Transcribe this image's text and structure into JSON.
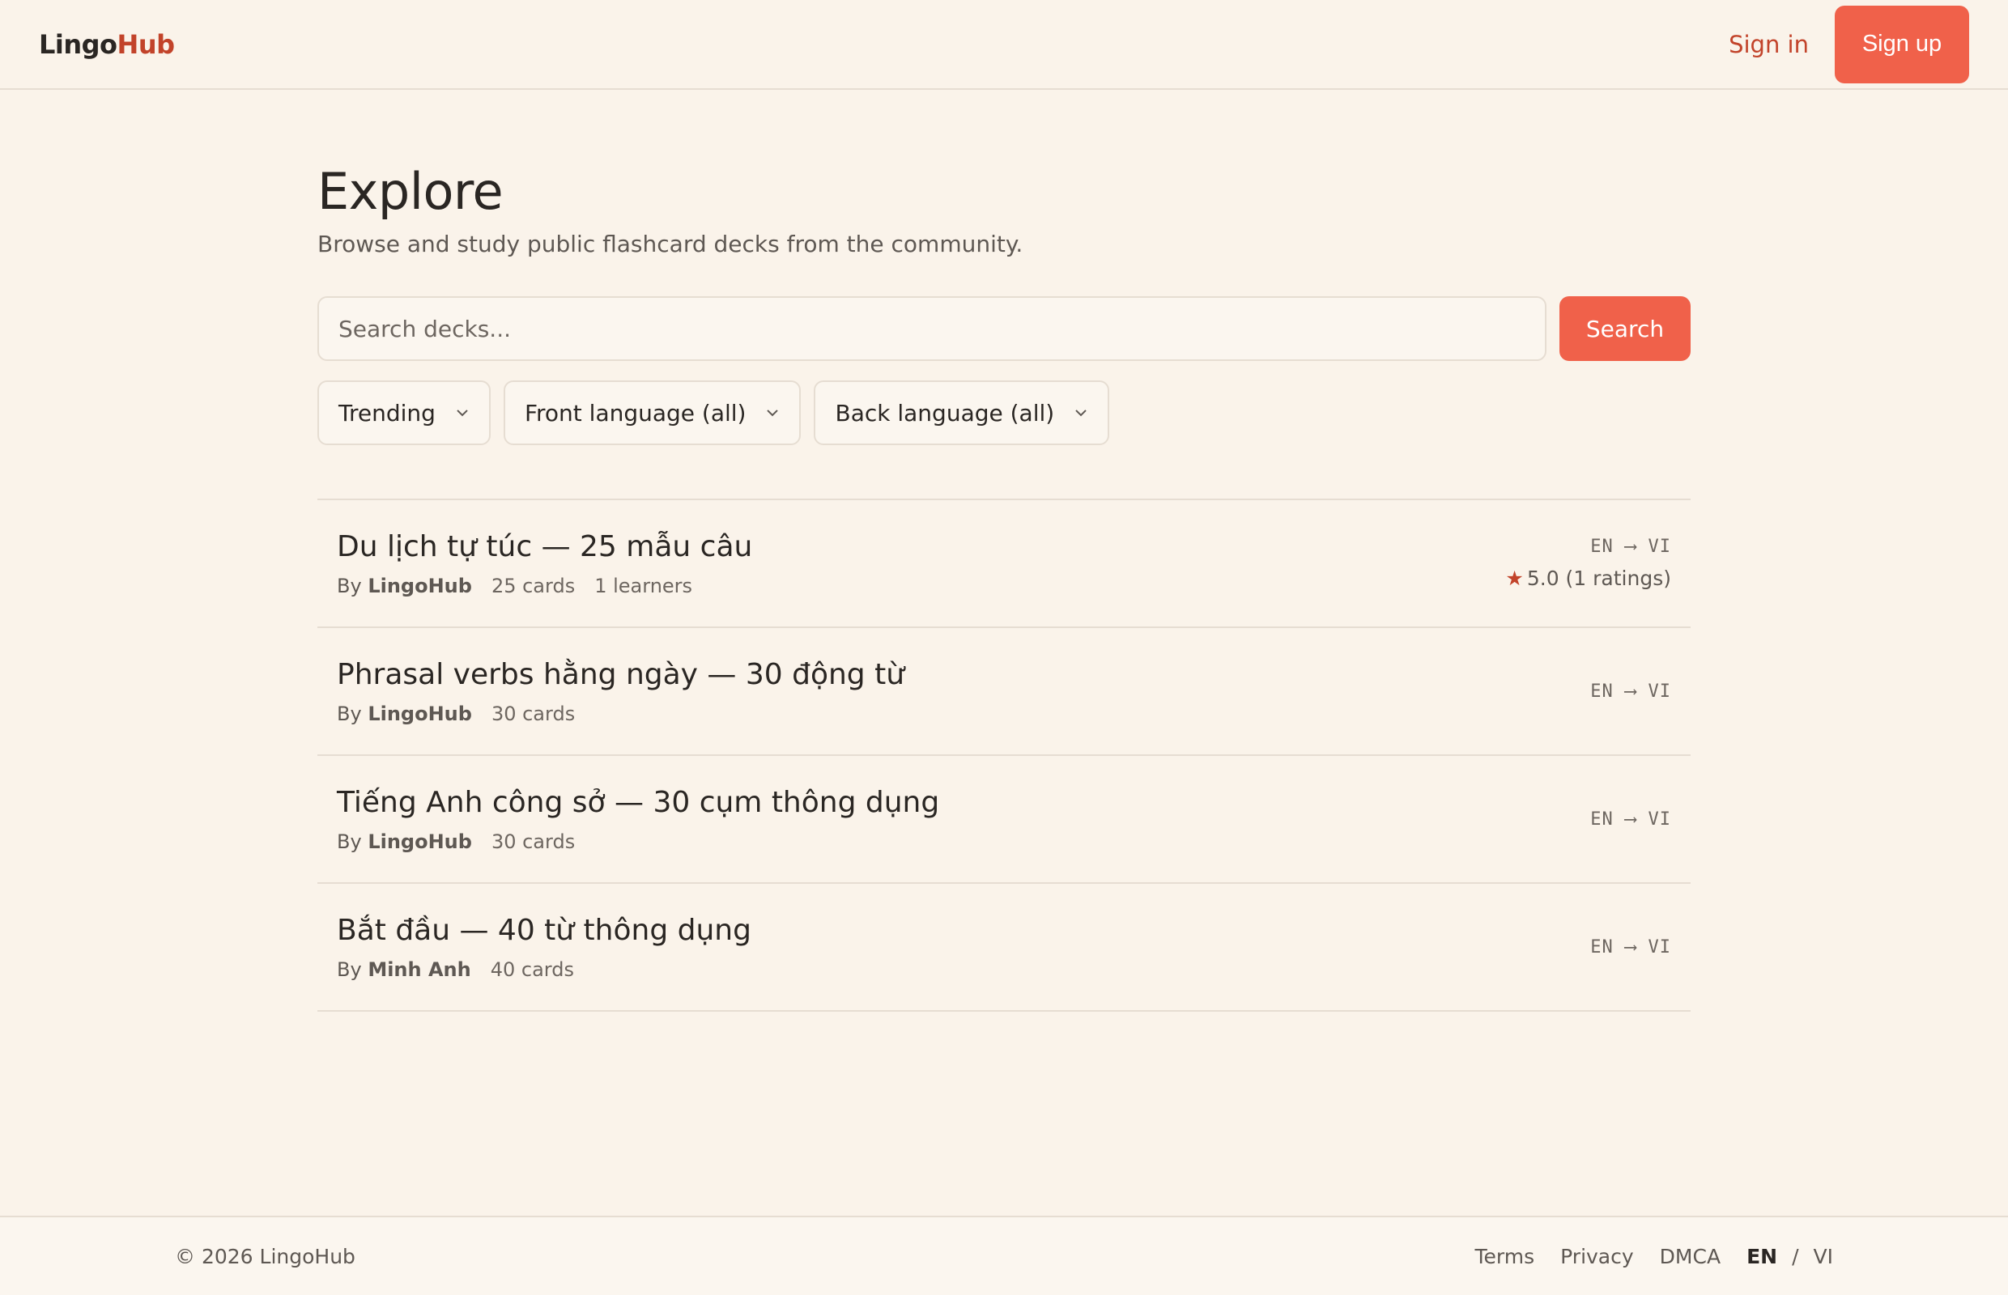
{
  "header": {
    "logo_part1": "Lingo",
    "logo_part2": "Hub",
    "signin_label": "Sign in",
    "signup_label": "Sign up"
  },
  "main": {
    "title": "Explore",
    "subtitle": "Browse and study public flashcard decks from the community.",
    "search": {
      "placeholder": "Search decks...",
      "value": "",
      "button_label": "Search"
    },
    "filters": {
      "sort": "Trending",
      "front_language": "Front language (all)",
      "back_language": "Back language (all)"
    },
    "decks": [
      {
        "title": "Du lịch tự túc — 25 mẫu câu",
        "by": "By",
        "author": "LingoHub",
        "cards": "25 cards",
        "learners": "1 learners",
        "langs": "EN ⟶ VI",
        "rating": "5.0 (1 ratings)"
      },
      {
        "title": "Phrasal verbs hằng ngày — 30 động từ",
        "by": "By",
        "author": "LingoHub",
        "cards": "30 cards",
        "langs": "EN ⟶ VI"
      },
      {
        "title": "Tiếng Anh công sở — 30 cụm thông dụng",
        "by": "By",
        "author": "LingoHub",
        "cards": "30 cards",
        "langs": "EN ⟶ VI"
      },
      {
        "title": "Bắt đầu — 40 từ thông dụng",
        "by": "By",
        "author": "Minh Anh",
        "cards": "40 cards",
        "langs": "EN ⟶ VI"
      }
    ]
  },
  "footer": {
    "copyright": "© 2026 LingoHub",
    "links": [
      "Terms",
      "Privacy",
      "DMCA"
    ],
    "lang_en": "EN",
    "lang_sep": "/",
    "lang_vi": "VI"
  },
  "colors": {
    "accent": "#f0614a",
    "brand": "#c2432a",
    "background": "#faf3ea"
  }
}
